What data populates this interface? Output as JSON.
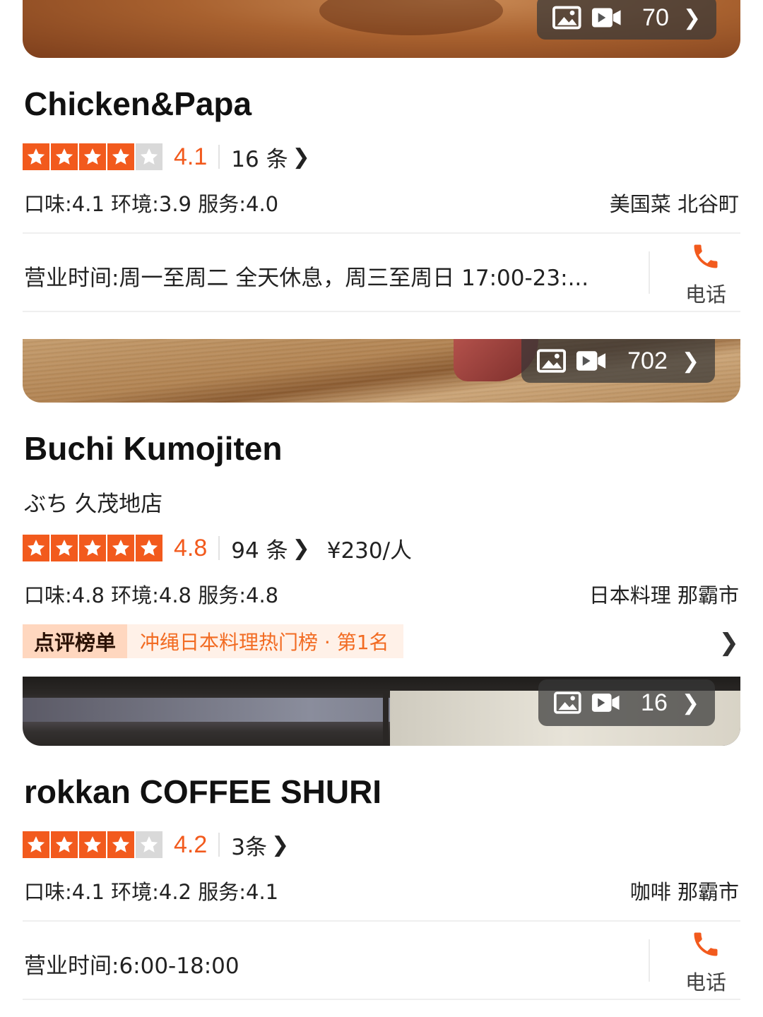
{
  "restaurants": [
    {
      "name": "Chicken&Papa",
      "alt_name": "",
      "media_count": "70",
      "stars": 4,
      "score": "4.1",
      "reviews": "16 条",
      "price": "",
      "scores_line": "口味:4.1 环境:3.9 服务:4.0",
      "category_area": "美国菜 北谷町",
      "hours": "营业时间:周一至周二 全天休息，周三至周日 17:00-23:...",
      "call_label": "电话"
    },
    {
      "name": "Buchi Kumojiten",
      "alt_name": "ぶち 久茂地店",
      "media_count": "702",
      "stars": 5,
      "score": "4.8",
      "reviews": "94 条",
      "price": "¥230/人",
      "scores_line": "口味:4.8 环境:4.8 服务:4.8",
      "category_area": "日本料理 那霸市",
      "rank_tag": "点评榜单",
      "rank_text": "冲绳日本料理热门榜 · 第1名"
    },
    {
      "name": "rokkan COFFEE SHURI",
      "alt_name": "",
      "media_count": "16",
      "stars": 4,
      "score": "4.2",
      "reviews": "3条",
      "price": "",
      "scores_line": "口味:4.1 环境:4.2 服务:4.1",
      "category_area": "咖啡 那霸市",
      "hours": "营业时间:6:00-18:00",
      "call_label": "电话"
    }
  ],
  "icons": {
    "photo": "image-icon",
    "video": "video-camera-icon",
    "chevron": "chevron-right-icon",
    "phone": "phone-icon",
    "star": "star-icon"
  },
  "colors": {
    "accent": "#f25a1d",
    "star_off": "#d9d9d9",
    "rank_tag_bg": "#ffd7bf",
    "rank_text_bg": "#fff1e8",
    "rank_text": "#f26b22"
  }
}
